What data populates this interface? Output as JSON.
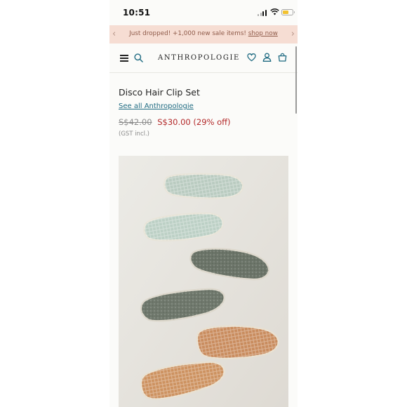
{
  "status_bar": {
    "time": "10:51"
  },
  "promo": {
    "text": "Just dropped! +1,000 new sale items!",
    "link": "shop now"
  },
  "header": {
    "brand": "ANTHROPOLOGIE",
    "icons": [
      "menu-icon",
      "search-icon",
      "heart-icon",
      "account-icon",
      "bag-icon"
    ]
  },
  "product": {
    "title": "Disco Hair Clip Set",
    "see_all": "See all Anthropologie",
    "original_price": "S$42.00",
    "sale_price": "S$30.00 (29% off)",
    "tax_note": "(GST incl.)"
  },
  "colors": {
    "promo_bg": "#f6ddd3",
    "promo_text": "#8f5a49",
    "link": "#1f6b82",
    "sale": "#b3292a",
    "clip_mint": "#bccdc2",
    "clip_olive": "#6f776b",
    "clip_copper": "#c98c5e"
  }
}
